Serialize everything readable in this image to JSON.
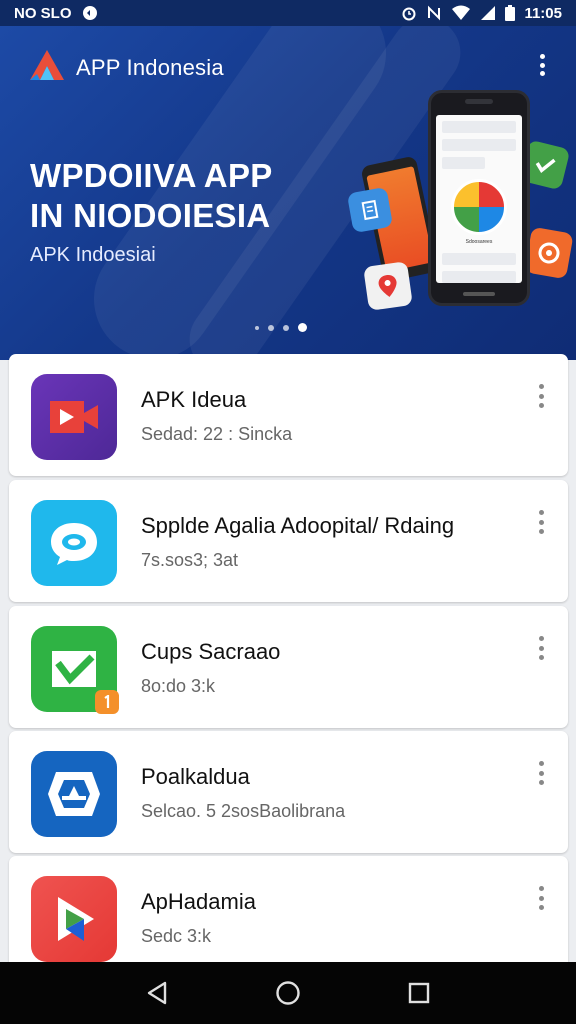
{
  "status_bar": {
    "left_text": "NO SLO",
    "time": "11:05",
    "icons": [
      "settings-sync-icon",
      "alarm-icon",
      "nfc-icon",
      "wifi-icon",
      "signal-icon",
      "battery-icon"
    ]
  },
  "hero": {
    "brand_name": "APP Indonesia",
    "title_line1": "WPDOIIVA APP",
    "title_line2": "IN NIODOIESIA",
    "subtitle": "APK Indoesiai",
    "carousel_pages": 4,
    "carousel_active_index": 3,
    "phone_label": "Sdoosarees"
  },
  "apps": [
    {
      "name": "APK Ideua",
      "meta": "Sedad: 22 : Sincka",
      "icon": "video-play-icon",
      "color": "#5a2ea6"
    },
    {
      "name": "Spplde Agalia Adoopital/ Rdaing",
      "meta": "7s.sos3; 3at",
      "icon": "chat-bubble-icon",
      "color": "#1fb8ec"
    },
    {
      "name": "Cups Sacraao",
      "meta": "8o:do 3:k",
      "icon": "check-leaf-icon",
      "color": "#2fb344"
    },
    {
      "name": "Poalkaldua",
      "meta": "Selcao. 5 2sosBaolibrana",
      "icon": "a-shield-icon",
      "color": "#1565c0"
    },
    {
      "name": "ApHadamia",
      "meta": "Sedc 3:k",
      "icon": "play-triangle-icon",
      "color": "#e53935"
    }
  ],
  "navigation": {
    "buttons": [
      "back-icon",
      "home-icon",
      "recents-icon"
    ]
  }
}
